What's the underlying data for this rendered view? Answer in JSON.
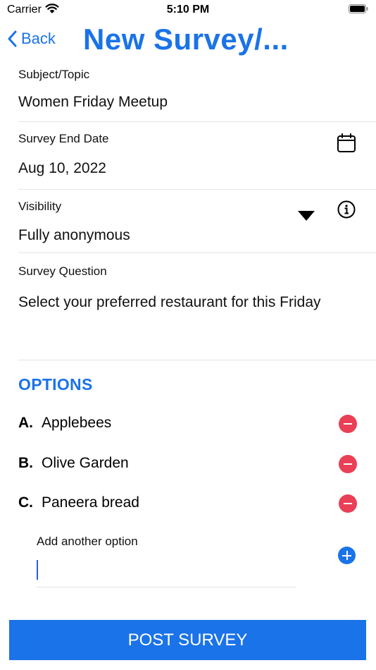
{
  "status_bar": {
    "carrier": "Carrier",
    "time": "5:10 PM"
  },
  "nav": {
    "back_label": "Back",
    "title": "New Survey/..."
  },
  "subject": {
    "label": "Subject/Topic",
    "value": "Women Friday Meetup"
  },
  "end_date": {
    "label": "Survey End Date",
    "value": "Aug 10, 2022"
  },
  "visibility": {
    "label": "Visibility",
    "value": "Fully anonymous"
  },
  "question": {
    "label": "Survey Question",
    "value": "Select your preferred restaurant for this Friday"
  },
  "options": {
    "heading": "OPTIONS",
    "items": [
      {
        "letter": "A.",
        "text": "Applebees"
      },
      {
        "letter": "B.",
        "text": "Olive Garden"
      },
      {
        "letter": "C.",
        "text": "Paneera bread"
      }
    ],
    "add_label": "Add another option",
    "add_value": ""
  },
  "post_button": "POST SURVEY",
  "colors": {
    "accent": "#1a73e8",
    "remove": "#e94057"
  }
}
